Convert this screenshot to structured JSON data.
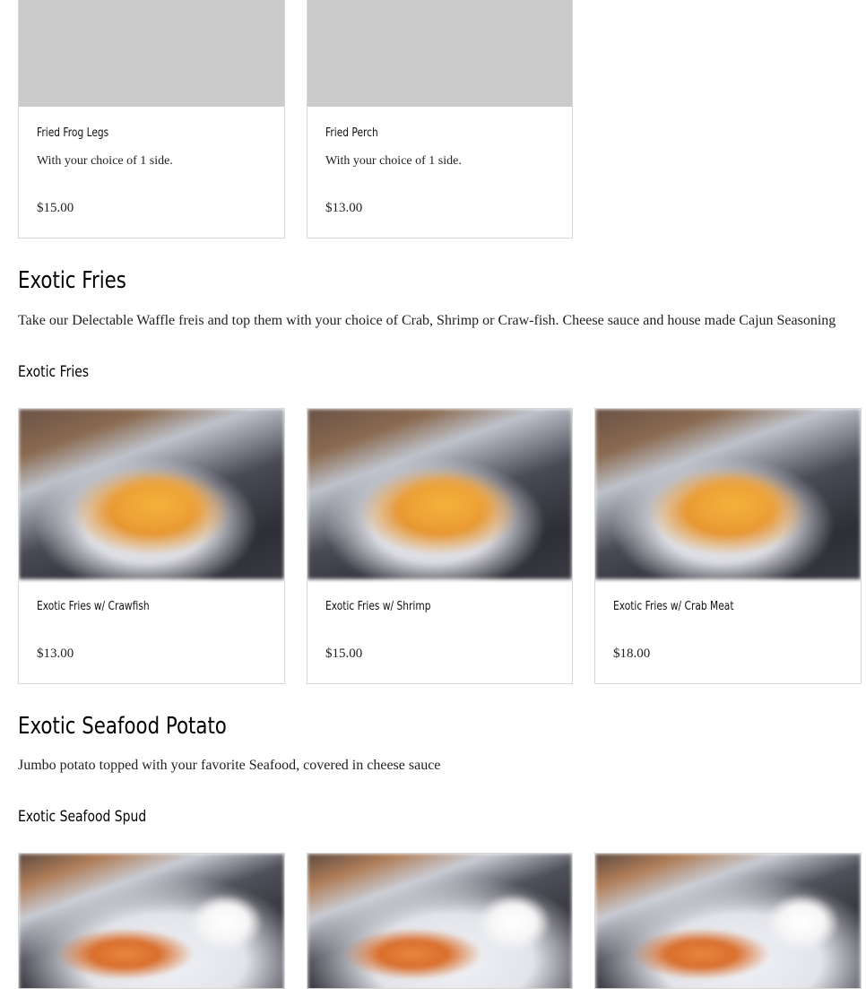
{
  "top_items": [
    {
      "name": "Fried Frog Legs",
      "description": "With your choice of 1 side.",
      "price": "$15.00"
    },
    {
      "name": "Fried Perch",
      "description": "With your choice of 1 side.",
      "price": "$13.00"
    }
  ],
  "sections": {
    "exotic_fries": {
      "title": "Exotic Fries",
      "description": "Take our Delectable Waffle freis and top them with your choice of Crab, Shrimp or Craw-fish. Cheese sauce and house made Cajun Seasoning",
      "subsection_title": "Exotic Fries",
      "items": [
        {
          "name": "Exotic Fries w/ Crawfish",
          "price": "$13.00"
        },
        {
          "name": "Exotic Fries w/ Shrimp",
          "price": "$15.00"
        },
        {
          "name": "Exotic Fries w/ Crab Meat",
          "price": "$18.00"
        }
      ]
    },
    "exotic_potato": {
      "title": "Exotic Seafood Potato",
      "description": "Jumbo potato topped with your favorite Seafood, covered in cheese sauce",
      "subsection_title": "Exotic Seafood Spud"
    }
  }
}
